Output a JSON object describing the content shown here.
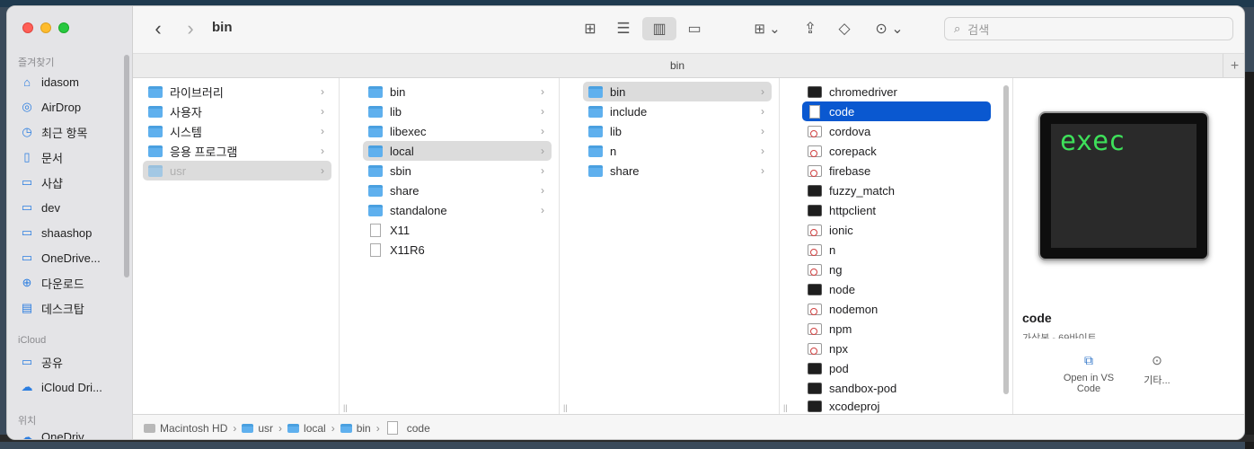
{
  "toolbar": {
    "title": "bin",
    "search_placeholder": "검색"
  },
  "tab": {
    "title": "bin"
  },
  "sidebar": {
    "favorites_heading": "즐겨찾기",
    "favorites": [
      {
        "label": "idasom",
        "icon": "home-icon"
      },
      {
        "label": "AirDrop",
        "icon": "airdrop-icon"
      },
      {
        "label": "최근 항목",
        "icon": "clock-icon"
      },
      {
        "label": "문서",
        "icon": "document-icon"
      },
      {
        "label": "사샵",
        "icon": "folder-icon"
      },
      {
        "label": "dev",
        "icon": "folder-icon"
      },
      {
        "label": "shaashop",
        "icon": "folder-icon"
      },
      {
        "label": "OneDrive...",
        "icon": "folder-icon"
      },
      {
        "label": "다운로드",
        "icon": "download-icon"
      },
      {
        "label": "데스크탑",
        "icon": "desktop-icon"
      }
    ],
    "icloud_heading": "iCloud",
    "icloud": [
      {
        "label": "공유",
        "icon": "shared-folder-icon"
      },
      {
        "label": "iCloud Dri...",
        "icon": "cloud-icon"
      }
    ],
    "locations_heading": "위치",
    "locations_partial": "OneDriv..."
  },
  "columns": [
    {
      "items": [
        {
          "label": "라이브러리",
          "type": "folder",
          "chevron": true
        },
        {
          "label": "사용자",
          "type": "folder",
          "chevron": true
        },
        {
          "label": "시스템",
          "type": "folder",
          "chevron": true
        },
        {
          "label": "응용 프로그램",
          "type": "folder",
          "chevron": true
        },
        {
          "label": "usr",
          "type": "folder",
          "chevron": true,
          "state": "selected-inactive"
        }
      ]
    },
    {
      "items": [
        {
          "label": "bin",
          "type": "folder",
          "chevron": true
        },
        {
          "label": "lib",
          "type": "folder",
          "chevron": true
        },
        {
          "label": "libexec",
          "type": "folder",
          "chevron": true
        },
        {
          "label": "local",
          "type": "folder",
          "chevron": true,
          "state": "selected-inactive"
        },
        {
          "label": "sbin",
          "type": "folder",
          "chevron": true
        },
        {
          "label": "share",
          "type": "folder",
          "chevron": true
        },
        {
          "label": "standalone",
          "type": "folder",
          "chevron": true
        },
        {
          "label": "X11",
          "type": "alias"
        },
        {
          "label": "X11R6",
          "type": "alias"
        }
      ]
    },
    {
      "items": [
        {
          "label": "bin",
          "type": "folder",
          "chevron": true,
          "state": "selected-inactive"
        },
        {
          "label": "include",
          "type": "folder",
          "chevron": true
        },
        {
          "label": "lib",
          "type": "folder",
          "chevron": true
        },
        {
          "label": "n",
          "type": "folder",
          "chevron": true
        },
        {
          "label": "share",
          "type": "folder",
          "chevron": true
        }
      ]
    },
    {
      "items": [
        {
          "label": "chromedriver",
          "type": "terminal"
        },
        {
          "label": "code",
          "type": "alias",
          "state": "selected"
        },
        {
          "label": "cordova",
          "type": "script"
        },
        {
          "label": "corepack",
          "type": "script"
        },
        {
          "label": "firebase",
          "type": "script"
        },
        {
          "label": "fuzzy_match",
          "type": "terminal"
        },
        {
          "label": "httpclient",
          "type": "terminal"
        },
        {
          "label": "ionic",
          "type": "script"
        },
        {
          "label": "n",
          "type": "script"
        },
        {
          "label": "ng",
          "type": "script"
        },
        {
          "label": "node",
          "type": "terminal"
        },
        {
          "label": "nodemon",
          "type": "script"
        },
        {
          "label": "npm",
          "type": "script"
        },
        {
          "label": "npx",
          "type": "script"
        },
        {
          "label": "pod",
          "type": "terminal"
        },
        {
          "label": "sandbox-pod",
          "type": "terminal"
        },
        {
          "label": "xcodeproj",
          "type": "terminal"
        }
      ]
    }
  ],
  "preview": {
    "thumb_text": "exec",
    "name": "code",
    "kind": "가상본 - 69바이트",
    "actions": [
      {
        "label": "Open in VS Code",
        "icon": "vscode-icon"
      },
      {
        "label": "기타...",
        "icon": "more-icon"
      }
    ]
  },
  "pathbar": [
    {
      "label": "Macintosh HD",
      "icon": "disk-icon"
    },
    {
      "label": "usr",
      "icon": "folder-icon"
    },
    {
      "label": "local",
      "icon": "folder-icon"
    },
    {
      "label": "bin",
      "icon": "folder-icon"
    },
    {
      "label": "code",
      "icon": "alias-icon"
    }
  ],
  "colors": {
    "selection": "#0a58d0",
    "folder": "#5fb0ee",
    "accent": "#2b7de0"
  }
}
